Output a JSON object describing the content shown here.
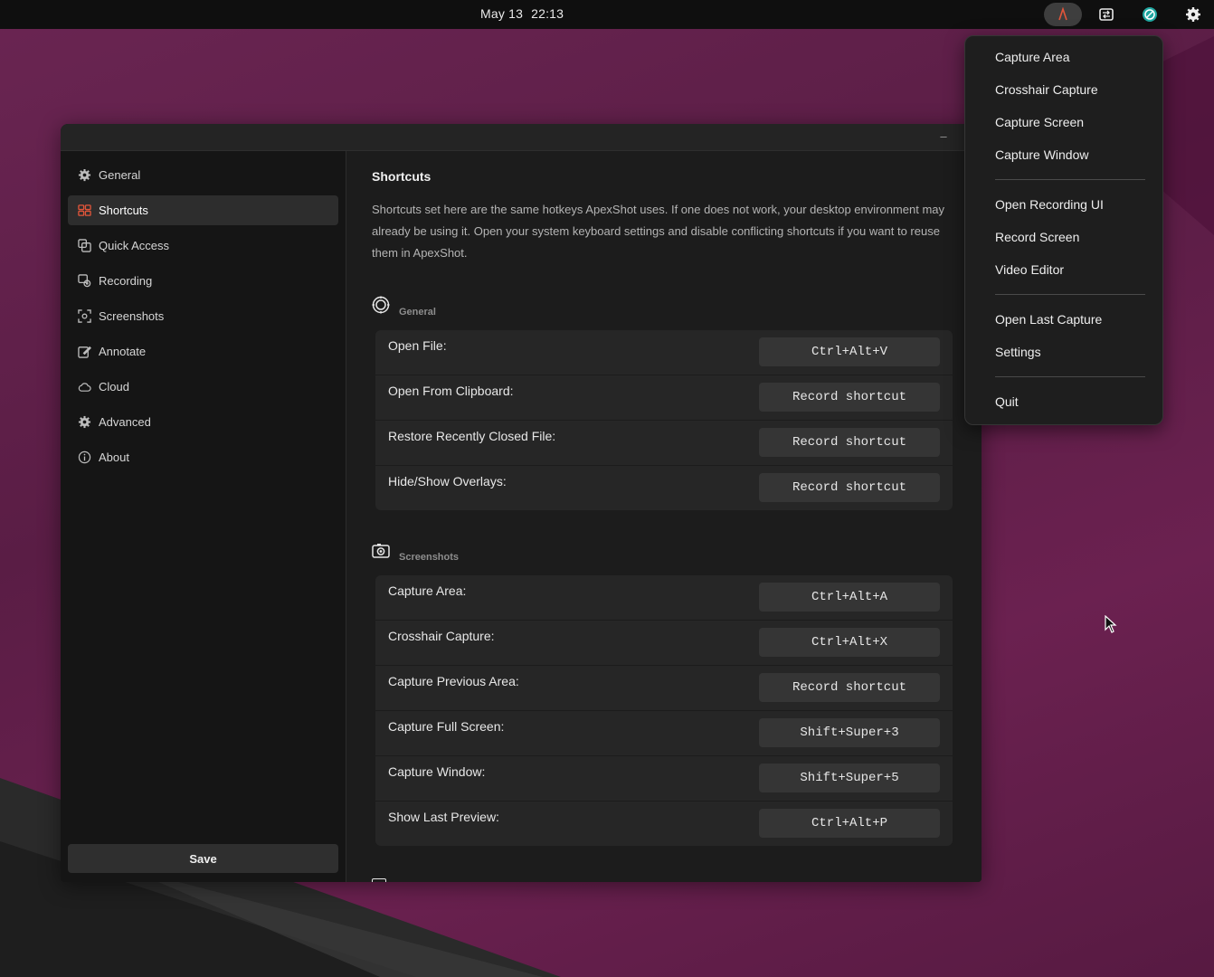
{
  "topbar": {
    "date": "May 13",
    "time": "22:13",
    "tray_icons": [
      "apexshot-tray-icon",
      "screen-share-icon",
      "vpn-globe-icon",
      "settings-gear-icon"
    ]
  },
  "window": {
    "minimize_label": "–"
  },
  "sidebar": {
    "items": [
      {
        "label": "General",
        "icon": "gear-icon"
      },
      {
        "label": "Shortcuts",
        "icon": "shortcuts-grid-icon",
        "active": true
      },
      {
        "label": "Quick Access",
        "icon": "copy-stack-icon"
      },
      {
        "label": "Recording",
        "icon": "recording-icon"
      },
      {
        "label": "Screenshots",
        "icon": "screenshot-frame-icon"
      },
      {
        "label": "Annotate",
        "icon": "edit-square-icon"
      },
      {
        "label": "Cloud",
        "icon": "cloud-icon"
      },
      {
        "label": "Advanced",
        "icon": "advanced-gear-icon"
      },
      {
        "label": "About",
        "icon": "info-icon"
      }
    ],
    "save_label": "Save"
  },
  "content": {
    "title": "Shortcuts",
    "description": "Shortcuts set here are the same hotkeys ApexShot uses. If one does not work, your desktop environment may already be using it. Open your system keyboard settings and disable conflicting shortcuts if you want to reuse them in ApexShot.",
    "sections": [
      {
        "label": "General",
        "icon": "general-section-icon",
        "rows": [
          {
            "label": "Open File:",
            "shortcut": "Ctrl+Alt+V"
          },
          {
            "label": "Open From Clipboard:",
            "shortcut": "Record shortcut"
          },
          {
            "label": "Restore Recently Closed File:",
            "shortcut": "Record shortcut"
          },
          {
            "label": "Hide/Show Overlays:",
            "shortcut": "Record shortcut"
          }
        ]
      },
      {
        "label": "Screenshots",
        "icon": "camera-icon",
        "rows": [
          {
            "label": "Capture Area:",
            "shortcut": "Ctrl+Alt+A"
          },
          {
            "label": "Crosshair Capture:",
            "shortcut": "Ctrl+Alt+X"
          },
          {
            "label": "Capture Previous Area:",
            "shortcut": "Record shortcut"
          },
          {
            "label": "Capture Full Screen:",
            "shortcut": "Shift+Super+3"
          },
          {
            "label": "Capture Window:",
            "shortcut": "Shift+Super+5"
          },
          {
            "label": "Show Last Preview:",
            "shortcut": "Ctrl+Alt+P"
          }
        ]
      }
    ]
  },
  "tray_menu": {
    "groups": [
      [
        "Capture Area",
        "Crosshair Capture",
        "Capture Screen",
        "Capture Window"
      ],
      [
        "Open Recording UI",
        "Record Screen",
        "Video Editor"
      ],
      [
        "Open Last Capture",
        "Settings"
      ],
      [
        "Quit"
      ]
    ]
  },
  "colors": {
    "accent": "#e2553a",
    "desktop": "#5e1f48",
    "window_bg": "#1c1c1c",
    "sidebar_bg": "#151515"
  }
}
